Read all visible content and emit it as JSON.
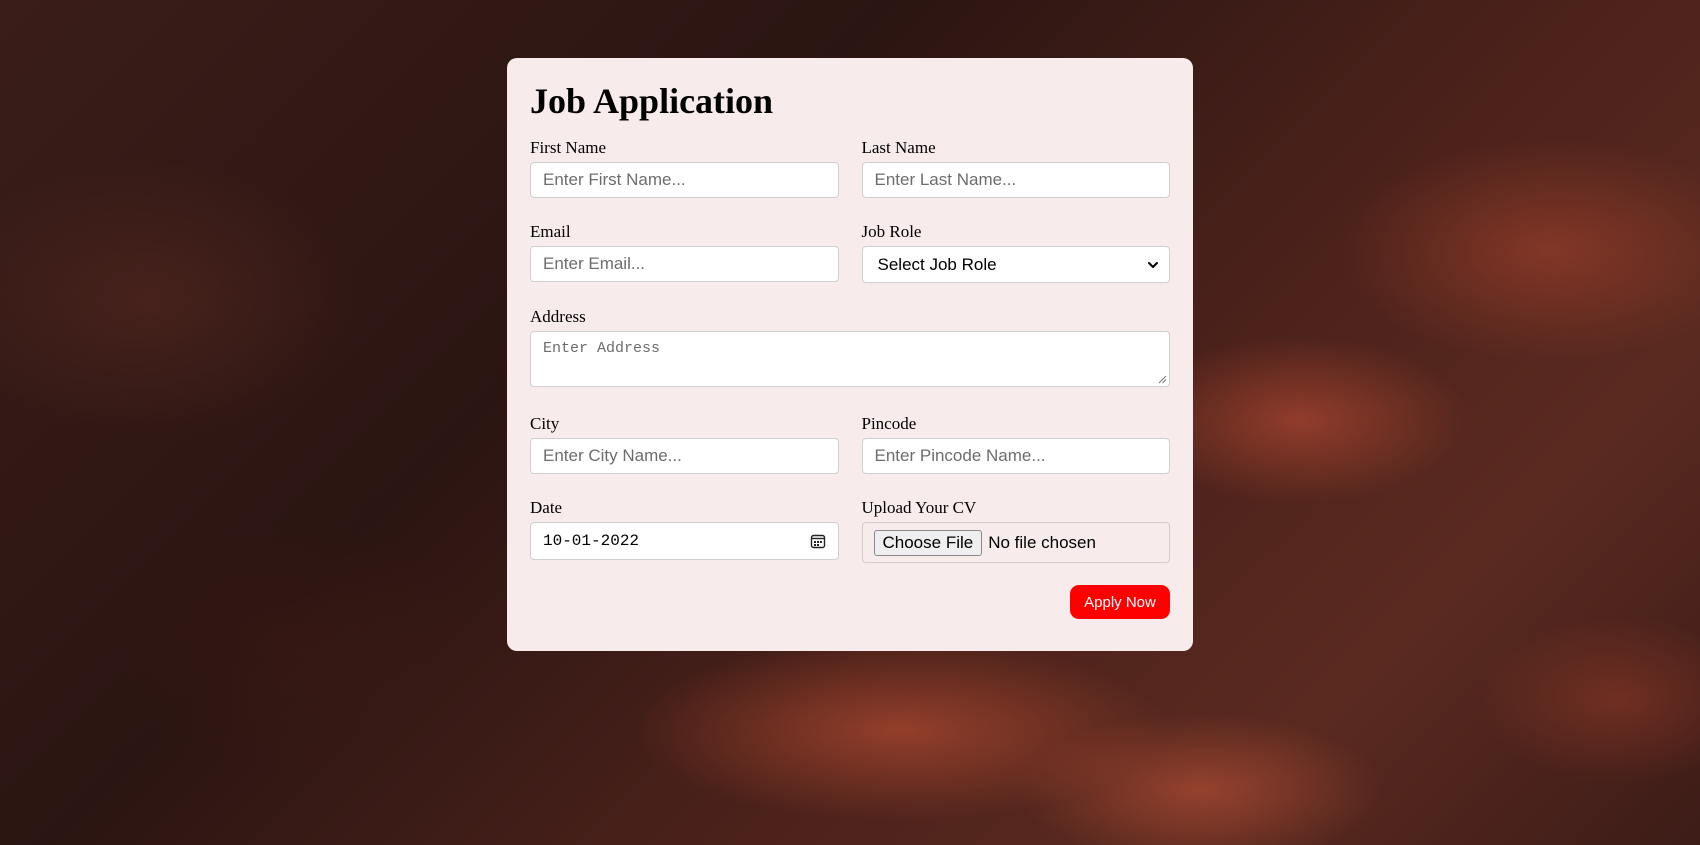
{
  "form": {
    "title": "Job Application",
    "first_name": {
      "label": "First Name",
      "placeholder": "Enter First Name...",
      "value": ""
    },
    "last_name": {
      "label": "Last Name",
      "placeholder": "Enter Last Name...",
      "value": ""
    },
    "email": {
      "label": "Email",
      "placeholder": "Enter Email...",
      "value": ""
    },
    "job_role": {
      "label": "Job Role",
      "selected": "Select Job Role"
    },
    "address": {
      "label": "Address",
      "placeholder": "Enter Address"
    },
    "city": {
      "label": "City",
      "placeholder": "Enter City Name...",
      "value": ""
    },
    "pincode": {
      "label": "Pincode",
      "placeholder": "Enter Pincode Name...",
      "value": ""
    },
    "date": {
      "label": "Date",
      "value": "10-01-2022"
    },
    "cv": {
      "label": "Upload Your CV",
      "button_label": "Choose File",
      "status": "No file chosen"
    },
    "submit_label": "Apply Now"
  },
  "colors": {
    "card_background": "#f8ebeb",
    "submit_background": "#ff0000",
    "submit_text": "#ffffff"
  },
  "icons": {
    "job_role_dropdown": "chevron-down-icon",
    "date_picker": "calendar-icon",
    "address_resize": "resize-handle-icon"
  }
}
